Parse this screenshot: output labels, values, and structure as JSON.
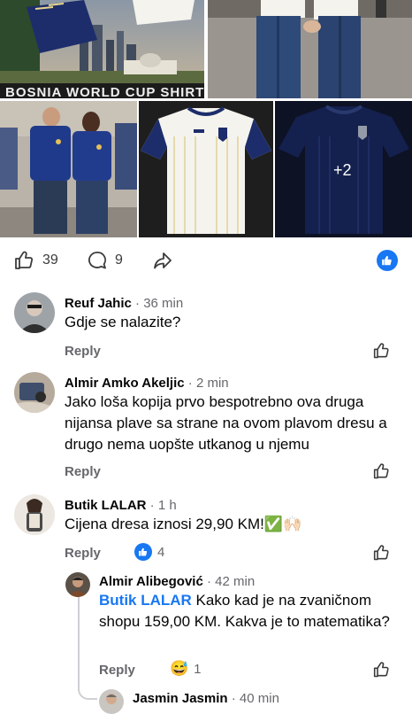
{
  "post": {
    "banner_text": "BOSNIA WORLD CUP SHIRT",
    "more_photos": "+2",
    "likes": "39",
    "comments": "9"
  },
  "comments": [
    {
      "author": "Reuf Jahic",
      "time": "· 36 min",
      "text": "Gdje se nalazite?",
      "reply": "Reply"
    },
    {
      "author": "Almir Amko Akeljic",
      "time": "· 2 min",
      "text": "Jako loša kopija prvo bespotrebno ova druga nijansa plave sa strane na ovom plavom dresu a drugo nema uopšte utkanog u njemu",
      "reply": "Reply"
    },
    {
      "author": "Butik LALAR",
      "time": "· 1 h",
      "text": "Cijena dresa iznosi 29,90 KM!",
      "emoji": "✅🙌🏻",
      "reply": "Reply",
      "reactions": "4"
    },
    {
      "author": "Almir Alibegović",
      "time": "· 42 min",
      "mention": "Butik LALAR",
      "text": " Kako kad je na zvaničnom shopu 159,00 KM. Kakva je to matematika?",
      "reply": "Reply",
      "reaction_emoji": "😅",
      "reactions": "1"
    },
    {
      "author": "Jasmin Jasmin",
      "time": "· 40 min"
    }
  ],
  "colors": {
    "accent": "#1877f2",
    "secondary_text": "#65676b",
    "jersey_navy": "#1d2d6b",
    "jersey_white": "#f4f3ee"
  }
}
